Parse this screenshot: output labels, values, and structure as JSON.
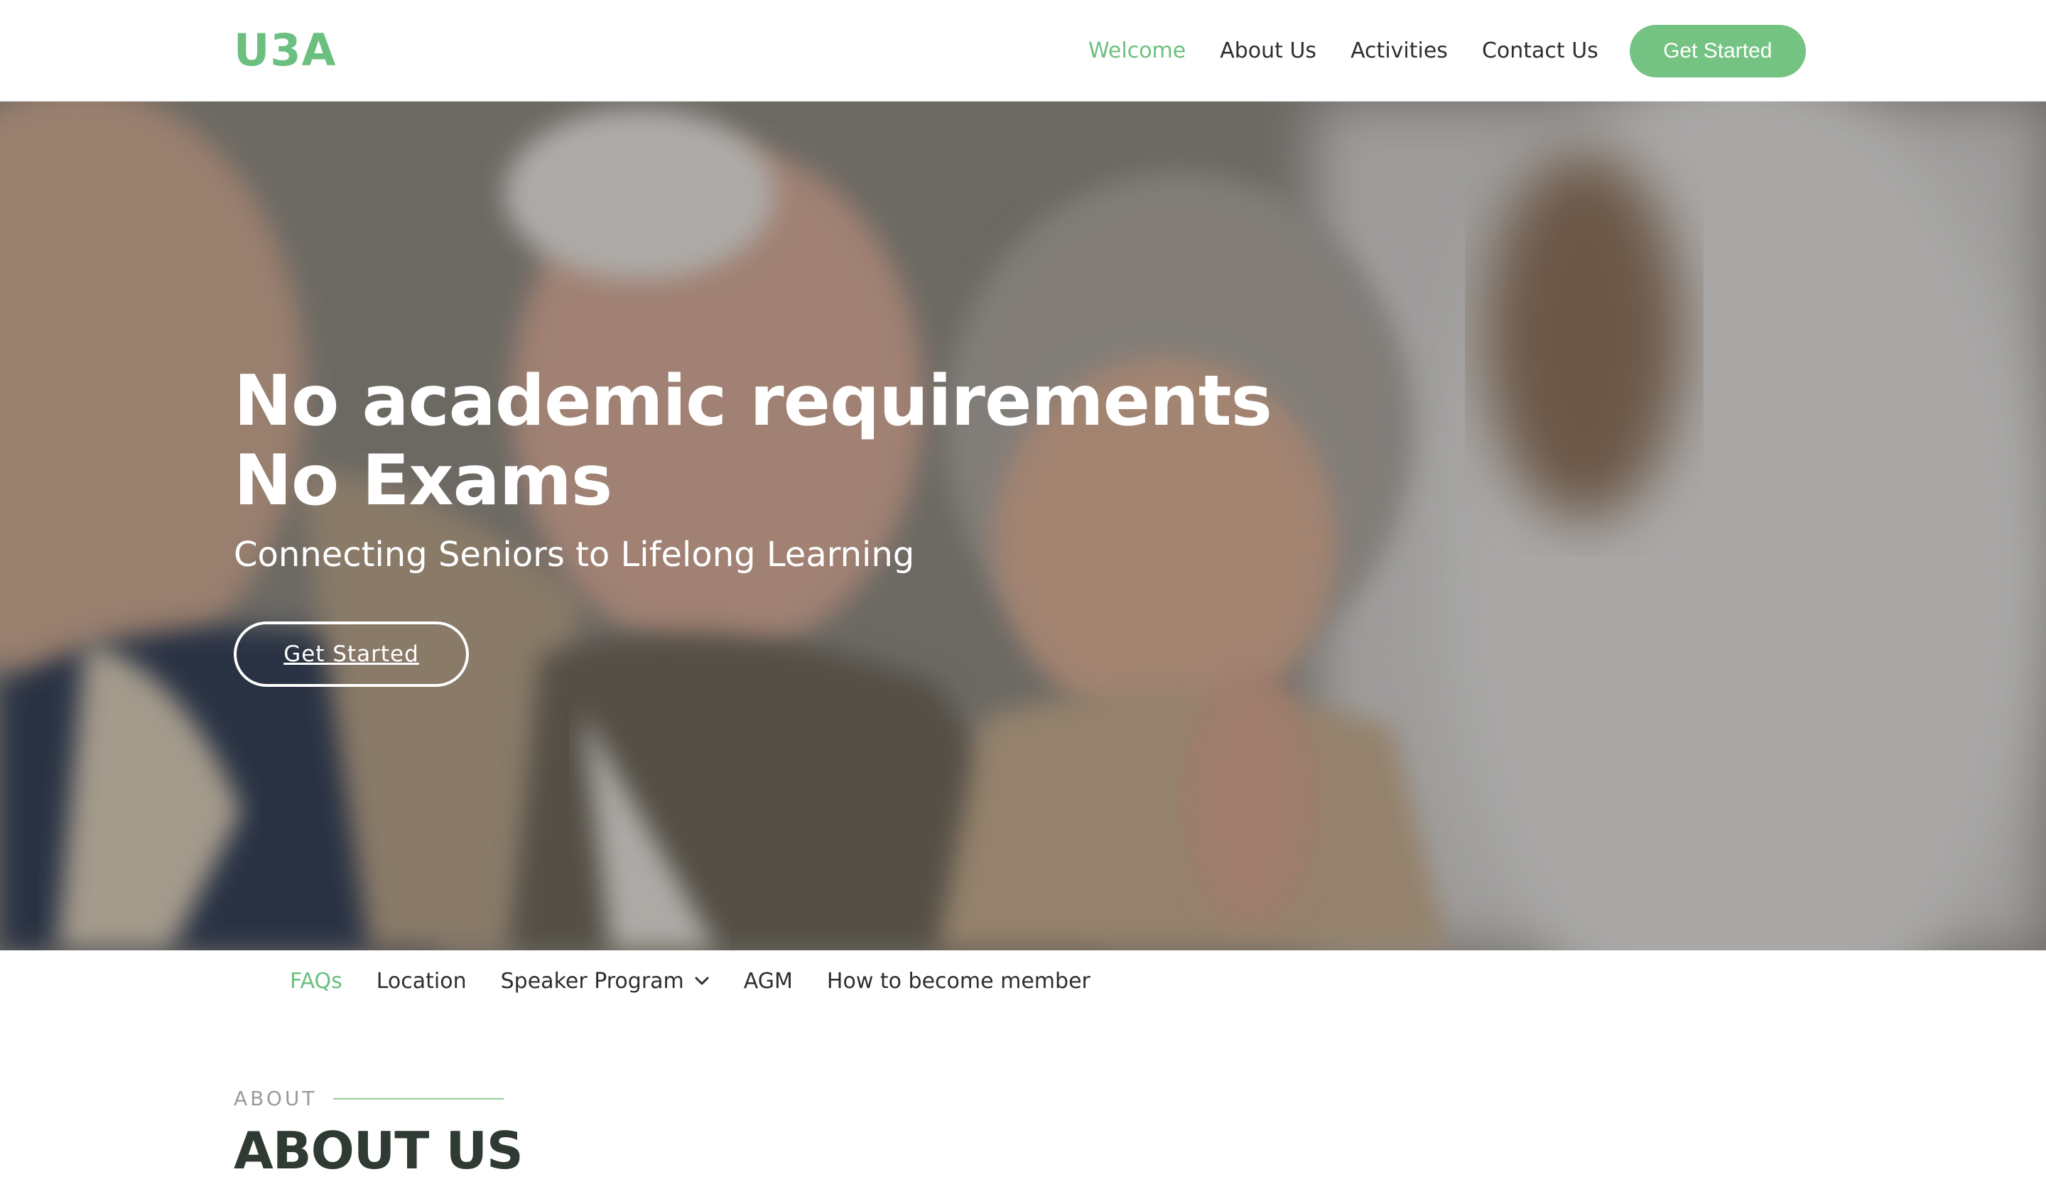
{
  "header": {
    "logo": "U3A",
    "nav": [
      {
        "label": "Welcome",
        "active": true
      },
      {
        "label": "About Us",
        "active": false
      },
      {
        "label": "Activities",
        "active": false
      },
      {
        "label": "Contact Us",
        "active": false
      }
    ],
    "cta_label": "Get Started"
  },
  "hero": {
    "title_line1": "No academic requirements",
    "title_line2": "No Exams",
    "subtitle": "Connecting Seniors to Lifelong Learning",
    "button_label": "Get Started"
  },
  "subnav": [
    {
      "label": "FAQs",
      "active": true
    },
    {
      "label": "Location",
      "active": false
    },
    {
      "label": "Speaker Program",
      "active": false,
      "has_dropdown": true
    },
    {
      "label": "AGM",
      "active": false
    },
    {
      "label": "How to become member",
      "active": false
    }
  ],
  "about": {
    "eyebrow": "ABOUT",
    "title": "ABOUT US"
  },
  "colors": {
    "accent": "#6cc07f",
    "button_bg": "#75c383",
    "text_dark": "#2e2e2e",
    "heading_dark": "#2f3a33"
  }
}
